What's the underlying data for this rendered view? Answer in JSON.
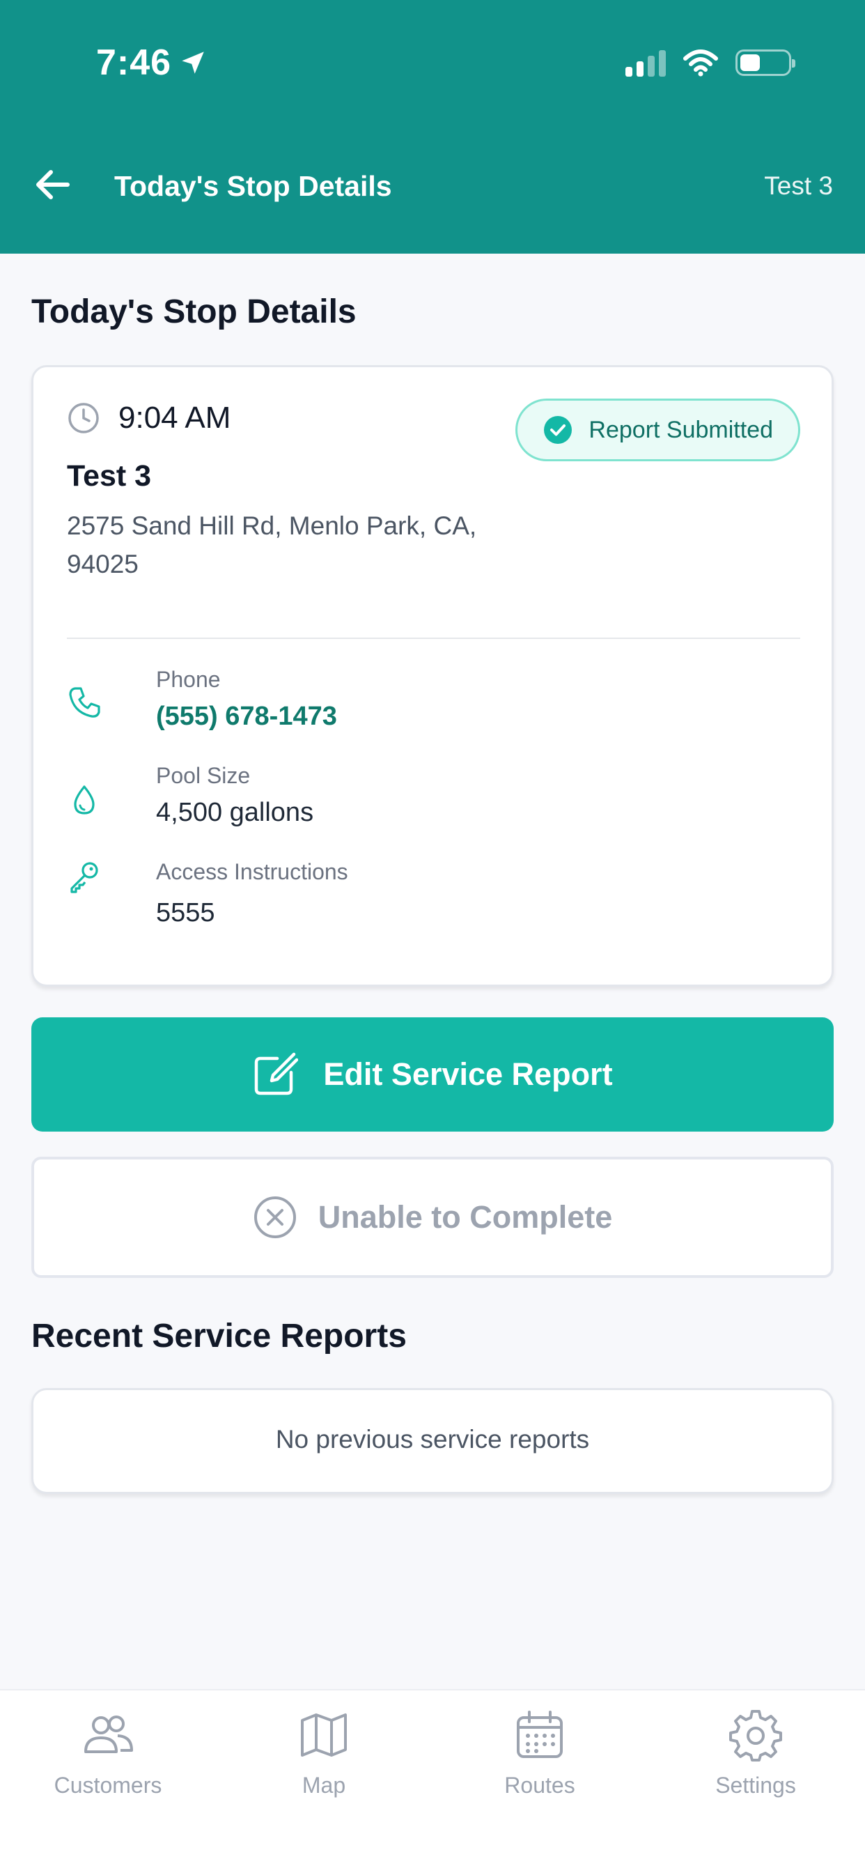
{
  "status_bar": {
    "time": "7:46"
  },
  "header": {
    "title": "Today's Stop Details",
    "right_label": "Test 3"
  },
  "page": {
    "section_title": "Today's Stop Details"
  },
  "stop": {
    "time": "9:04 AM",
    "badge": "Report Submitted",
    "customer_name": "Test 3",
    "address": "2575 Sand Hill Rd, Menlo Park, CA, 94025",
    "phone_label": "Phone",
    "phone_value": "(555) 678-1473",
    "pool_size_label": "Pool Size",
    "pool_size_value": "4,500 gallons",
    "access_label": "Access Instructions",
    "access_value": "5555"
  },
  "actions": {
    "edit_label": "Edit Service Report",
    "unable_label": "Unable to Complete"
  },
  "recent": {
    "title": "Recent Service Reports",
    "empty_text": "No previous service reports"
  },
  "tabbar": {
    "tabs": [
      {
        "label": "Customers",
        "icon": "users-icon"
      },
      {
        "label": "Map",
        "icon": "map-icon"
      },
      {
        "label": "Routes",
        "icon": "calendar-icon"
      },
      {
        "label": "Settings",
        "icon": "gear-icon"
      }
    ]
  },
  "colors": {
    "header": "#11928a",
    "accent": "#14b8a6",
    "link": "#0f7a6c",
    "muted": "#9ca3af"
  }
}
